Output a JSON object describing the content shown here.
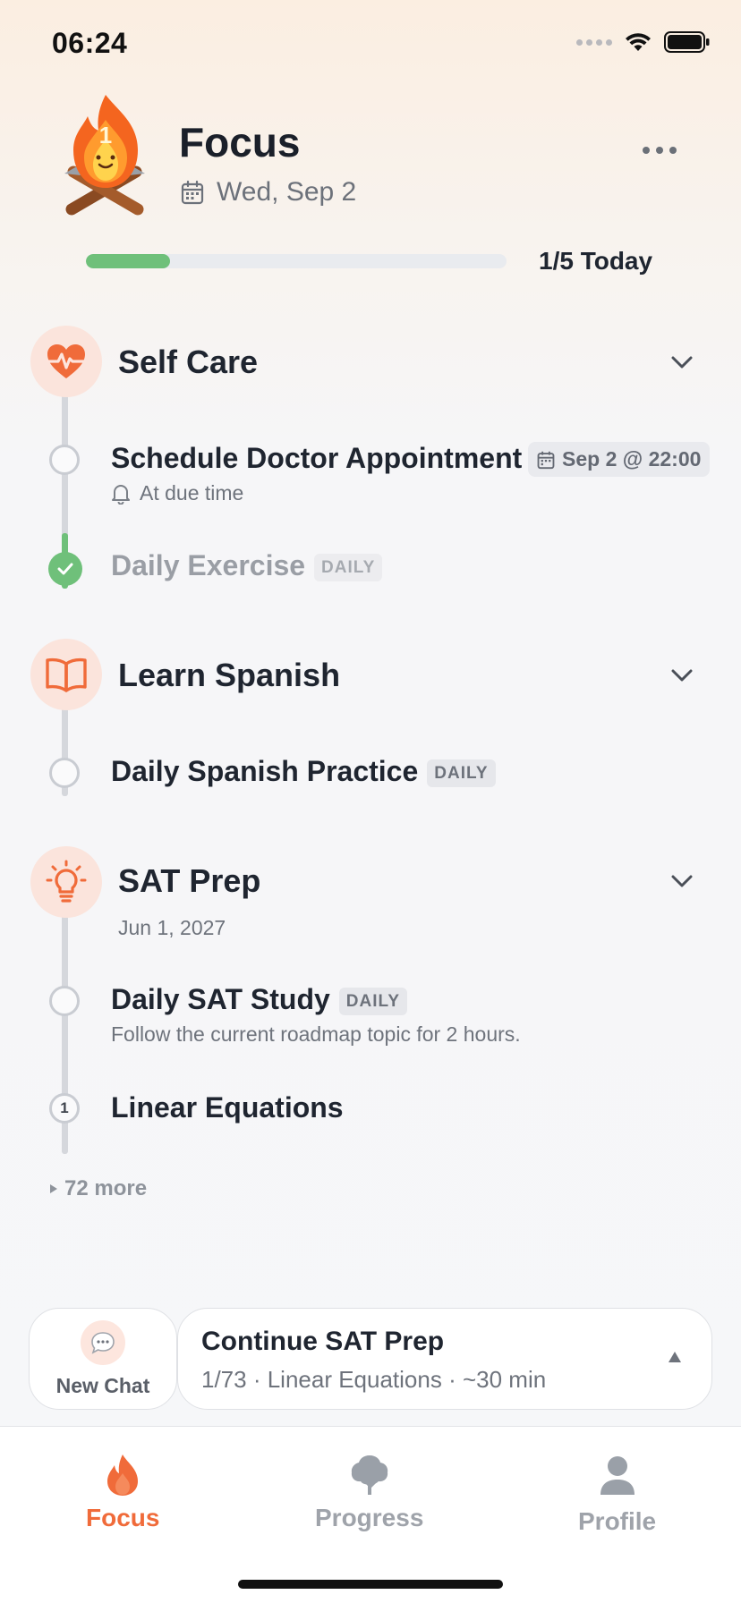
{
  "status_bar": {
    "time": "06:24"
  },
  "header": {
    "title": "Focus",
    "date": "Wed, Sep 2",
    "progress_fraction": 0.2,
    "progress_text": "1/5 Today",
    "mascot_digit": "1"
  },
  "categories": [
    {
      "title": "Self Care",
      "icon": "heart-pulse-icon",
      "tasks": [
        {
          "title": "Schedule Doctor Appointment",
          "due": "Sep 2 @ 22:00",
          "reminder": "At due time",
          "done": false
        },
        {
          "title": "Daily Exercise",
          "badge": "DAILY",
          "done": true
        }
      ]
    },
    {
      "title": "Learn Spanish",
      "icon": "book-open-icon",
      "tasks": [
        {
          "title": "Daily Spanish Practice",
          "badge": "DAILY",
          "done": false
        }
      ]
    },
    {
      "title": "SAT Prep",
      "icon": "lightbulb-icon",
      "deadline": "Jun 1, 2027",
      "tasks": [
        {
          "title": "Daily SAT Study",
          "badge": "DAILY",
          "note": "Follow the current roadmap topic for 2 hours.",
          "done": false
        },
        {
          "title": "Linear Equations",
          "step": "1",
          "done": false
        }
      ],
      "more": "72 more"
    }
  ],
  "actions": {
    "new_chat": "New Chat",
    "continue_title": "Continue SAT Prep",
    "continue_sub": "1/73 · Linear Equations · ~30 min"
  },
  "tabs": [
    {
      "label": "Focus",
      "icon": "flame-icon",
      "active": true
    },
    {
      "label": "Progress",
      "icon": "tree-icon",
      "active": false
    },
    {
      "label": "Profile",
      "icon": "person-icon",
      "active": false
    }
  ],
  "colors": {
    "accent": "#f06b3a",
    "success": "#6fc07a",
    "rail": "#d5d7dc"
  }
}
